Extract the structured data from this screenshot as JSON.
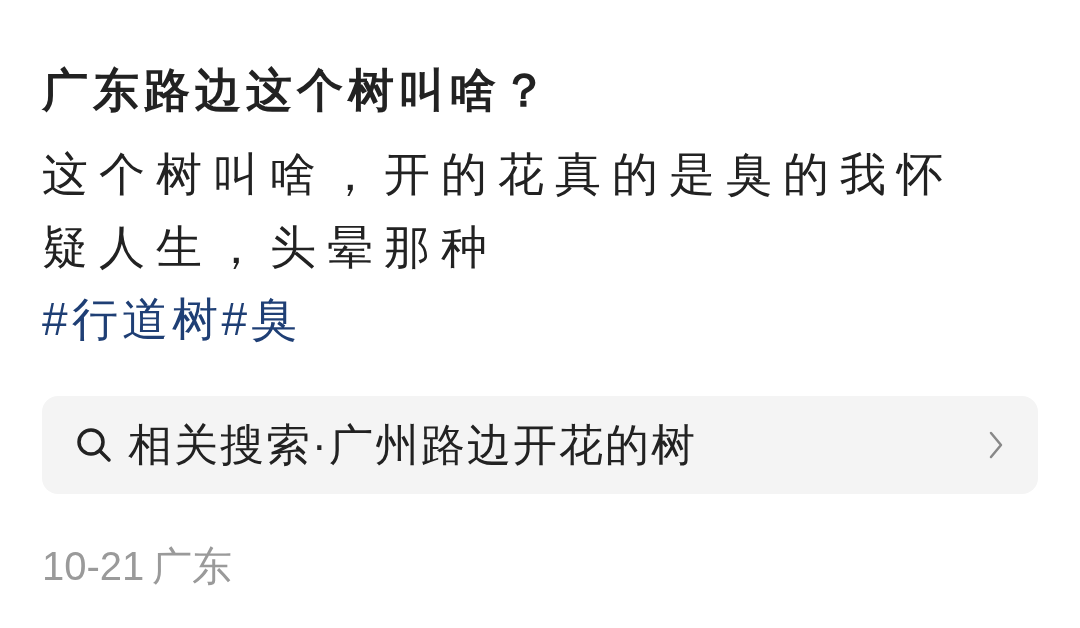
{
  "post": {
    "title": "广东路边这个树叫啥？",
    "body": "这个树叫啥，开的花真的是臭的我怀疑人生，头晕那种",
    "tags": [
      {
        "text": "#行道树"
      },
      {
        "text": "#臭"
      }
    ]
  },
  "related_search": {
    "text": "相关搜索·广州路边开花的树"
  },
  "meta": {
    "date": "10-21",
    "location": "广东"
  }
}
